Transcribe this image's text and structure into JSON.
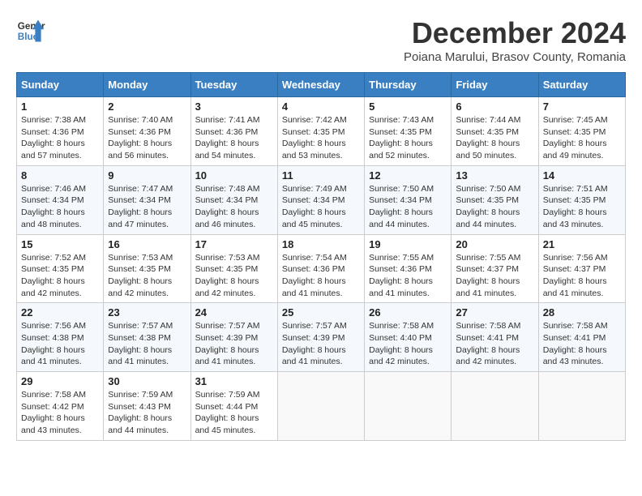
{
  "header": {
    "logo_line1": "General",
    "logo_line2": "Blue",
    "title": "December 2024",
    "location": "Poiana Marului, Brasov County, Romania"
  },
  "weekdays": [
    "Sunday",
    "Monday",
    "Tuesday",
    "Wednesday",
    "Thursday",
    "Friday",
    "Saturday"
  ],
  "weeks": [
    [
      {
        "day": 1,
        "sunrise": "7:38 AM",
        "sunset": "4:36 PM",
        "daylight": "8 hours and 57 minutes."
      },
      {
        "day": 2,
        "sunrise": "7:40 AM",
        "sunset": "4:36 PM",
        "daylight": "8 hours and 56 minutes."
      },
      {
        "day": 3,
        "sunrise": "7:41 AM",
        "sunset": "4:36 PM",
        "daylight": "8 hours and 54 minutes."
      },
      {
        "day": 4,
        "sunrise": "7:42 AM",
        "sunset": "4:35 PM",
        "daylight": "8 hours and 53 minutes."
      },
      {
        "day": 5,
        "sunrise": "7:43 AM",
        "sunset": "4:35 PM",
        "daylight": "8 hours and 52 minutes."
      },
      {
        "day": 6,
        "sunrise": "7:44 AM",
        "sunset": "4:35 PM",
        "daylight": "8 hours and 50 minutes."
      },
      {
        "day": 7,
        "sunrise": "7:45 AM",
        "sunset": "4:35 PM",
        "daylight": "8 hours and 49 minutes."
      }
    ],
    [
      {
        "day": 8,
        "sunrise": "7:46 AM",
        "sunset": "4:34 PM",
        "daylight": "8 hours and 48 minutes."
      },
      {
        "day": 9,
        "sunrise": "7:47 AM",
        "sunset": "4:34 PM",
        "daylight": "8 hours and 47 minutes."
      },
      {
        "day": 10,
        "sunrise": "7:48 AM",
        "sunset": "4:34 PM",
        "daylight": "8 hours and 46 minutes."
      },
      {
        "day": 11,
        "sunrise": "7:49 AM",
        "sunset": "4:34 PM",
        "daylight": "8 hours and 45 minutes."
      },
      {
        "day": 12,
        "sunrise": "7:50 AM",
        "sunset": "4:34 PM",
        "daylight": "8 hours and 44 minutes."
      },
      {
        "day": 13,
        "sunrise": "7:50 AM",
        "sunset": "4:35 PM",
        "daylight": "8 hours and 44 minutes."
      },
      {
        "day": 14,
        "sunrise": "7:51 AM",
        "sunset": "4:35 PM",
        "daylight": "8 hours and 43 minutes."
      }
    ],
    [
      {
        "day": 15,
        "sunrise": "7:52 AM",
        "sunset": "4:35 PM",
        "daylight": "8 hours and 42 minutes."
      },
      {
        "day": 16,
        "sunrise": "7:53 AM",
        "sunset": "4:35 PM",
        "daylight": "8 hours and 42 minutes."
      },
      {
        "day": 17,
        "sunrise": "7:53 AM",
        "sunset": "4:35 PM",
        "daylight": "8 hours and 42 minutes."
      },
      {
        "day": 18,
        "sunrise": "7:54 AM",
        "sunset": "4:36 PM",
        "daylight": "8 hours and 41 minutes."
      },
      {
        "day": 19,
        "sunrise": "7:55 AM",
        "sunset": "4:36 PM",
        "daylight": "8 hours and 41 minutes."
      },
      {
        "day": 20,
        "sunrise": "7:55 AM",
        "sunset": "4:37 PM",
        "daylight": "8 hours and 41 minutes."
      },
      {
        "day": 21,
        "sunrise": "7:56 AM",
        "sunset": "4:37 PM",
        "daylight": "8 hours and 41 minutes."
      }
    ],
    [
      {
        "day": 22,
        "sunrise": "7:56 AM",
        "sunset": "4:38 PM",
        "daylight": "8 hours and 41 minutes."
      },
      {
        "day": 23,
        "sunrise": "7:57 AM",
        "sunset": "4:38 PM",
        "daylight": "8 hours and 41 minutes."
      },
      {
        "day": 24,
        "sunrise": "7:57 AM",
        "sunset": "4:39 PM",
        "daylight": "8 hours and 41 minutes."
      },
      {
        "day": 25,
        "sunrise": "7:57 AM",
        "sunset": "4:39 PM",
        "daylight": "8 hours and 41 minutes."
      },
      {
        "day": 26,
        "sunrise": "7:58 AM",
        "sunset": "4:40 PM",
        "daylight": "8 hours and 42 minutes."
      },
      {
        "day": 27,
        "sunrise": "7:58 AM",
        "sunset": "4:41 PM",
        "daylight": "8 hours and 42 minutes."
      },
      {
        "day": 28,
        "sunrise": "7:58 AM",
        "sunset": "4:41 PM",
        "daylight": "8 hours and 43 minutes."
      }
    ],
    [
      {
        "day": 29,
        "sunrise": "7:58 AM",
        "sunset": "4:42 PM",
        "daylight": "8 hours and 43 minutes."
      },
      {
        "day": 30,
        "sunrise": "7:59 AM",
        "sunset": "4:43 PM",
        "daylight": "8 hours and 44 minutes."
      },
      {
        "day": 31,
        "sunrise": "7:59 AM",
        "sunset": "4:44 PM",
        "daylight": "8 hours and 45 minutes."
      },
      null,
      null,
      null,
      null
    ]
  ]
}
